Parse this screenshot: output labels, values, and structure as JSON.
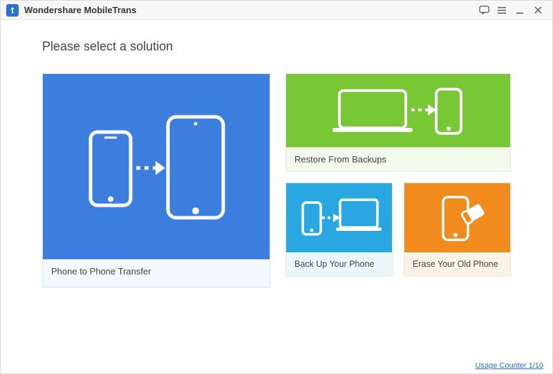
{
  "app": {
    "title": "Wondershare MobileTrans",
    "logo_letter": "t"
  },
  "heading": "Please select a solution",
  "cards": {
    "phone_to_phone": {
      "label": "Phone to Phone Transfer"
    },
    "restore": {
      "label": "Restore From Backups"
    },
    "backup": {
      "label": "Back Up Your Phone"
    },
    "erase": {
      "label": "Erase Your Old Phone"
    }
  },
  "footer": {
    "usage_counter_text": "Usage Counter 1/10"
  }
}
